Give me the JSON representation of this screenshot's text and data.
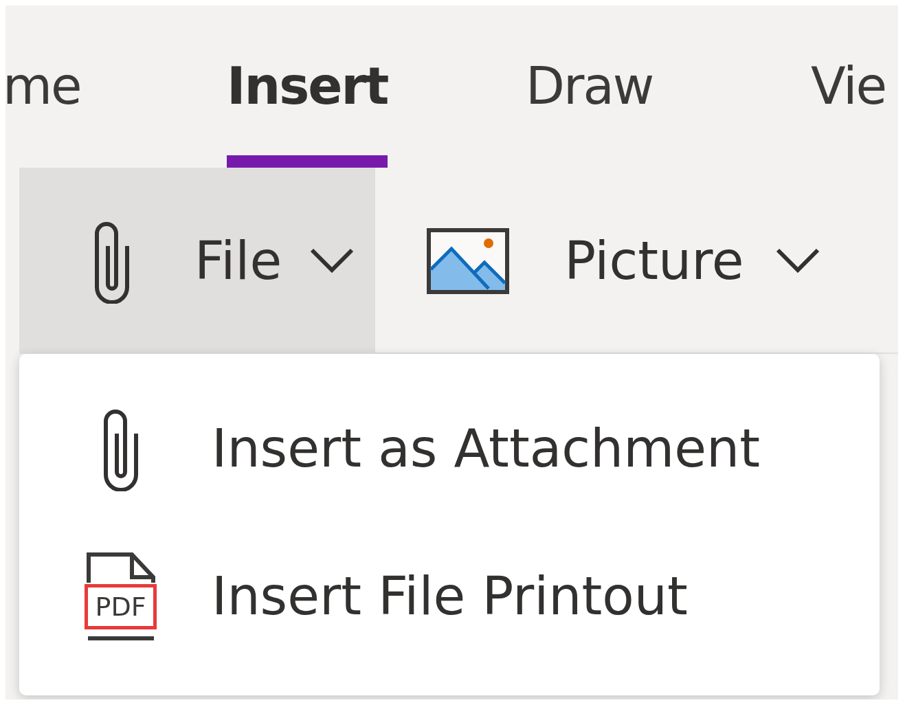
{
  "tabs": [
    {
      "label": "me",
      "selected": false
    },
    {
      "label": "Insert",
      "selected": true
    },
    {
      "label": "Draw",
      "selected": false
    },
    {
      "label": "Vie",
      "selected": false
    }
  ],
  "toolbar": [
    {
      "label": "File",
      "kind": "attach",
      "expanded": true
    },
    {
      "label": "Picture",
      "kind": "picture",
      "expanded": false
    }
  ],
  "menu": [
    {
      "label": "Insert as Attachment",
      "kind": "attach"
    },
    {
      "label": "Insert File Printout",
      "kind": "pdf",
      "icon_text": "PDF"
    }
  ]
}
